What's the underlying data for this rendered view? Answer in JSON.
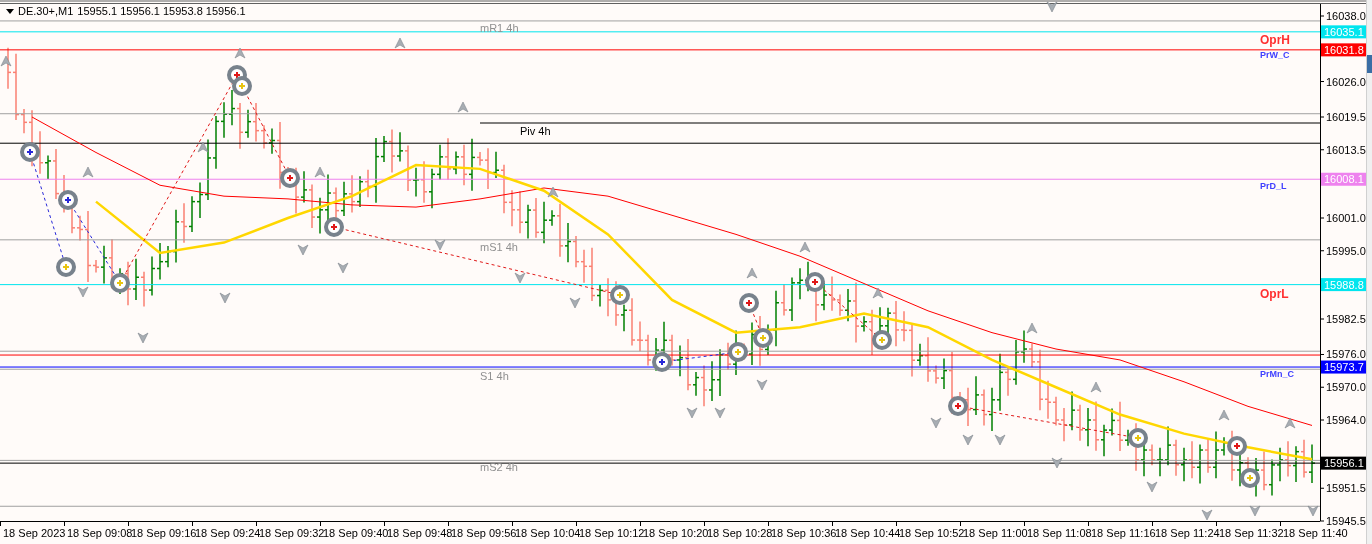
{
  "header": {
    "symbol": "DE.30+,M1",
    "ohlc": [
      "15955.1",
      "15956.1",
      "15953.8",
      "15956.1"
    ]
  },
  "chart": {
    "chart_data": {
      "type": "line",
      "categories": [
        "18 Sep 2023",
        "18 Sep 09:08",
        "18 Sep 09:16",
        "18 Sep 09:24",
        "18 Sep 09:32",
        "18 Sep 09:40",
        "18 Sep 09:48",
        "18 Sep 09:56",
        "18 Sep 10:04",
        "18 Sep 10:12",
        "18 Sep 10:20",
        "18 Sep 10:28",
        "18 Sep 10:36",
        "18 Sep 10:44",
        "18 Sep 10:52",
        "18 Sep 11:00",
        "18 Sep 11:08",
        "18 Sep 11:16",
        "18 Sep 11:24",
        "18 Sep 11:32",
        "18 Sep 11:40"
      ],
      "series": [
        {
          "color": "#ffd700",
          "values": [
            null,
            16004,
            15994.6,
            15996.5,
            16001,
            16005,
            16010.7,
            16010,
            16006,
            15998,
            15986,
            15980,
            15981,
            15983.5,
            15981,
            15975,
            15970,
            15965,
            15961.5,
            15959,
            15956.8
          ]
        },
        {
          "color": "#ff0000",
          "values": [
            16019.5,
            16013,
            16007,
            16005,
            16004.5,
            16003.4,
            16003,
            16004.5,
            16006.5,
            16005,
            16001.5,
            15998,
            15994,
            15989,
            15984,
            15980,
            15977,
            15975,
            15971,
            15966.5,
            15963
          ]
        }
      ],
      "ylim": [
        15945.5,
        16040.2
      ],
      "yticks": [
        {
          "value": 16038,
          "label": "16038.0"
        },
        {
          "value": 16026,
          "label": "16026.0"
        },
        {
          "value": 16019.5,
          "label": "16019.5"
        },
        {
          "value": 16013.5,
          "label": "16013.5"
        },
        {
          "value": 16001,
          "label": "16001.0"
        },
        {
          "value": 15995,
          "label": "15995.0"
        },
        {
          "value": 15982.5,
          "label": "15982.5"
        },
        {
          "value": 15976,
          "label": "15976.0"
        },
        {
          "value": 15970,
          "label": "15970.0"
        },
        {
          "value": 15964,
          "label": "15964.0"
        },
        {
          "value": 15951.5,
          "label": "15951.5"
        },
        {
          "value": 15945.5,
          "label": "15945.5"
        }
      ],
      "ref_lines": [
        {
          "axis": "y",
          "value": 16037.1,
          "color": "#a0a0a0",
          "label": "mR1 4h"
        },
        {
          "axis": "y",
          "value": 16035.1,
          "color": "#00e5ee",
          "label": "16035.1"
        },
        {
          "axis": "y",
          "value": 16031.8,
          "color": "#ff0000",
          "label": "16031.8"
        },
        {
          "axis": "y",
          "value": 16020.1,
          "color": "#a0a0a0"
        },
        {
          "axis": "y",
          "value": 16018.4,
          "color": "#000000",
          "label": "Piv 4h"
        },
        {
          "axis": "y",
          "value": 16014.7,
          "color": "#000000"
        },
        {
          "axis": "y",
          "value": 16008.1,
          "color": "#ee82ee",
          "label": "16008.1"
        },
        {
          "axis": "y",
          "value": 15997,
          "color": "#a0a0a0",
          "label": "mS1 4h"
        },
        {
          "axis": "y",
          "value": 15988.8,
          "color": "#00e5ee",
          "label": "15988.8"
        },
        {
          "axis": "y",
          "value": 15976.6,
          "color": "#a0a0a0"
        },
        {
          "axis": "y",
          "value": 15975.9,
          "color": "#ff0000"
        },
        {
          "axis": "y",
          "value": 15973.7,
          "color": "#0000ff",
          "label": "15973.7"
        },
        {
          "axis": "y",
          "value": 15973.3,
          "color": "#a0a0a0",
          "label": "S1 4h"
        },
        {
          "axis": "y",
          "value": 15956.6,
          "color": "#a0a0a0",
          "label": "mS2 4h"
        },
        {
          "axis": "y",
          "value": 15956.1,
          "color": "#000000",
          "label": "15956.1"
        },
        {
          "axis": "y",
          "value": 15948.2,
          "color": "#a0a0a0"
        }
      ]
    }
  },
  "side_labels": [
    {
      "text": "OprH",
      "color": "#ff3030",
      "kind": "large"
    },
    {
      "text": "PrW_C",
      "color": "#4040ff",
      "kind": "small"
    },
    {
      "text": "PrD_L",
      "color": "#4040ff",
      "kind": "small"
    },
    {
      "text": "OprL",
      "color": "#ff3030",
      "kind": "large"
    },
    {
      "text": "PrMn_C",
      "color": "#4040ff",
      "kind": "small"
    }
  ]
}
